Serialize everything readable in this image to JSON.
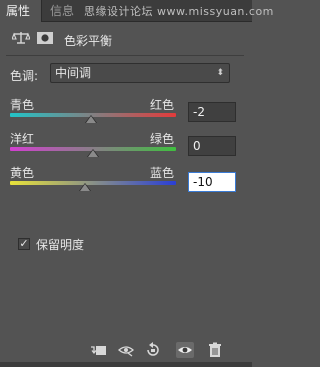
{
  "tabs": [
    {
      "label": "属性",
      "active": true
    },
    {
      "label": "信息",
      "active": false
    }
  ],
  "watermark": "思缘设计论坛 www.missyuan.com",
  "panel": {
    "title": "色彩平衡",
    "icons": [
      "balance-icon",
      "mask-icon"
    ]
  },
  "tone": {
    "label": "色调:",
    "selected": "中间调"
  },
  "sliders": [
    {
      "left": "青色",
      "right": "红色",
      "value": "-2",
      "level": -2,
      "colors": [
        "#22c4c8",
        "#e23b3b"
      ]
    },
    {
      "left": "洋红",
      "right": "绿色",
      "value": "0",
      "level": 0,
      "colors": [
        "#d23fd0",
        "#3fbf3f"
      ]
    },
    {
      "left": "黄色",
      "right": "蓝色",
      "value": "-10",
      "level": -10,
      "colors": [
        "#e8e23a",
        "#2a3fd6"
      ]
    }
  ],
  "preserve": {
    "label": "保留明度",
    "checked": true,
    "check_glyph": "✓"
  },
  "tone_arrow": "⬍",
  "bottom_icons": [
    "clip-to-layer-icon",
    "view-previous-icon",
    "reset-icon",
    "visibility-eye-icon",
    "delete-trash-icon"
  ]
}
